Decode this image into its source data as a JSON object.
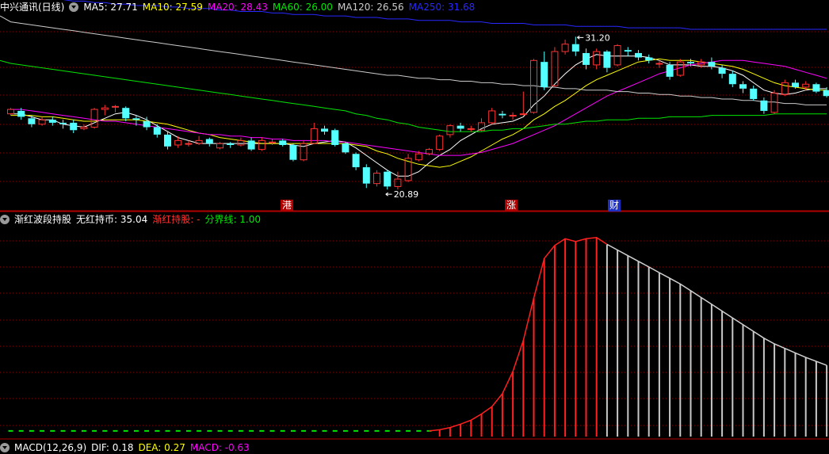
{
  "main_header": {
    "title": "中兴通讯(日线)",
    "ma5": "MA5: 27.71",
    "ma10": "MA10: 27.59",
    "ma20": "MA20: 28.43",
    "ma60": "MA60: 26.00",
    "ma120": "MA120: 26.56",
    "ma250": "MA250: 31.68"
  },
  "indicator_header": {
    "title": "渐红波段持股",
    "no_hold": "无红持币: 35.04",
    "hold": "渐红持股: -",
    "boundary": "分界线: 1.00"
  },
  "macd_header": {
    "title": "MACD(12,26,9)",
    "dif": "DIF: 0.18",
    "dea": "DEA: 0.27",
    "macd": "MACD: -0.63"
  },
  "annotations": {
    "high_label": "31.20",
    "low_label": "20.89",
    "tags": [
      "港",
      "涨",
      "财"
    ]
  },
  "colors": {
    "up": "#ff3232",
    "down": "#54ffff",
    "ma5": "#ffffff",
    "ma10": "#ffff00",
    "ma20": "#ff00ff",
    "ma60": "#00e600",
    "ma120": "#cccccc",
    "ma250": "#2828ff",
    "grid": "#8b0000"
  },
  "chart_data": [
    {
      "type": "candlestick",
      "ylim": [
        20,
        32.5
      ],
      "candles": [
        [
          26.0,
          26.3,
          26.4,
          25.9
        ],
        [
          26.2,
          25.8,
          26.4,
          25.6
        ],
        [
          25.7,
          25.3,
          25.9,
          25.1
        ],
        [
          25.3,
          25.6,
          25.8,
          25.2
        ],
        [
          25.6,
          25.4,
          25.8,
          25.2
        ],
        [
          25.4,
          25.3,
          25.6,
          25.0
        ],
        [
          25.4,
          24.9,
          25.6,
          24.7
        ],
        [
          25.0,
          25.1,
          25.3,
          24.9
        ],
        [
          25.1,
          26.3,
          26.4,
          25.0
        ],
        [
          26.3,
          26.4,
          26.6,
          25.9
        ],
        [
          26.5,
          26.5,
          26.6,
          26.1
        ],
        [
          26.4,
          25.7,
          26.5,
          25.5
        ],
        [
          25.7,
          25.6,
          25.9,
          25.2
        ],
        [
          25.5,
          25.1,
          25.8,
          24.9
        ],
        [
          25.1,
          24.6,
          25.3,
          24.4
        ],
        [
          24.6,
          23.8,
          24.8,
          23.6
        ],
        [
          23.9,
          24.2,
          24.5,
          23.7
        ],
        [
          24.0,
          24.0,
          24.2,
          23.8
        ],
        [
          24.0,
          24.2,
          24.5,
          23.9
        ],
        [
          24.3,
          24.0,
          24.4,
          23.8
        ],
        [
          23.7,
          24.0,
          24.1,
          23.6
        ],
        [
          24.0,
          23.9,
          24.1,
          23.7
        ],
        [
          23.9,
          24.2,
          24.4,
          23.8
        ],
        [
          24.2,
          23.6,
          24.4,
          23.5
        ],
        [
          23.6,
          24.2,
          24.4,
          23.5
        ],
        [
          24.1,
          24.1,
          24.3,
          23.9
        ],
        [
          24.2,
          23.9,
          24.3,
          23.8
        ],
        [
          23.9,
          22.9,
          24.0,
          22.8
        ],
        [
          22.9,
          24.0,
          24.2,
          22.8
        ],
        [
          24.0,
          25.0,
          25.4,
          24.0
        ],
        [
          25.0,
          24.8,
          25.2,
          24.6
        ],
        [
          24.9,
          23.9,
          25.0,
          23.8
        ],
        [
          24.0,
          23.4,
          24.1,
          23.3
        ],
        [
          23.3,
          22.4,
          23.4,
          22.2
        ],
        [
          22.4,
          21.3,
          22.6,
          21.0
        ],
        [
          21.3,
          22.0,
          22.2,
          21.1
        ],
        [
          22.1,
          21.1,
          22.2,
          20.9
        ],
        [
          21.1,
          21.6,
          22.1,
          20.9
        ],
        [
          21.5,
          23.0,
          23.3,
          21.4
        ],
        [
          22.9,
          23.3,
          23.5,
          22.8
        ],
        [
          23.3,
          23.6,
          23.7,
          23.2
        ],
        [
          23.6,
          24.5,
          24.6,
          23.5
        ],
        [
          24.6,
          25.2,
          25.3,
          24.4
        ],
        [
          25.2,
          25.0,
          25.4,
          24.8
        ],
        [
          25.0,
          25.0,
          25.2,
          24.8
        ],
        [
          24.9,
          25.4,
          25.7,
          24.8
        ],
        [
          25.4,
          26.2,
          26.4,
          25.3
        ],
        [
          26.0,
          25.9,
          26.2,
          25.7
        ],
        [
          25.9,
          25.9,
          26.1,
          25.6
        ],
        [
          26.0,
          26.0,
          27.5,
          25.9
        ],
        [
          26.1,
          29.6,
          29.7,
          26.0
        ],
        [
          29.5,
          27.8,
          30.2,
          27.6
        ],
        [
          27.9,
          30.2,
          30.5,
          27.8
        ],
        [
          30.2,
          30.7,
          31.0,
          30.0
        ],
        [
          30.7,
          30.2,
          31.2,
          29.9
        ],
        [
          30.1,
          29.3,
          30.4,
          29.0
        ],
        [
          29.3,
          30.2,
          30.4,
          29.0
        ],
        [
          30.2,
          29.1,
          30.3,
          28.8
        ],
        [
          29.3,
          30.6,
          30.7,
          29.2
        ],
        [
          30.3,
          30.2,
          30.5,
          29.9
        ],
        [
          30.1,
          29.8,
          30.3,
          29.6
        ],
        [
          29.8,
          29.6,
          30.0,
          29.4
        ],
        [
          29.4,
          29.4,
          29.6,
          29.1
        ],
        [
          29.3,
          28.5,
          29.5,
          28.3
        ],
        [
          28.6,
          29.5,
          29.7,
          28.5
        ],
        [
          29.5,
          29.4,
          29.7,
          29.2
        ],
        [
          29.3,
          29.5,
          29.7,
          29.1
        ],
        [
          29.5,
          29.2,
          29.8,
          29.0
        ],
        [
          29.1,
          28.7,
          29.3,
          28.4
        ],
        [
          28.7,
          28.0,
          28.9,
          27.8
        ],
        [
          28.0,
          27.7,
          28.2,
          27.4
        ],
        [
          27.7,
          27.0,
          27.9,
          26.9
        ],
        [
          26.9,
          26.2,
          27.1,
          26.0
        ],
        [
          26.1,
          27.4,
          27.6,
          26.0
        ],
        [
          27.3,
          28.1,
          28.3,
          27.2
        ],
        [
          28.1,
          27.8,
          28.3,
          27.7
        ],
        [
          27.8,
          28.0,
          28.2,
          27.6
        ],
        [
          28.0,
          27.5,
          28.1,
          27.4
        ],
        [
          27.6,
          27.2,
          27.8,
          27.1
        ]
      ],
      "ma_lines": {
        "ma5": [
          26.0,
          26.0,
          25.8,
          25.6,
          25.6,
          25.3,
          25.2,
          25.1,
          25.4,
          25.7,
          26.0,
          26.1,
          25.9,
          25.6,
          25.2,
          24.8,
          24.4,
          24.2,
          24.0,
          24.0,
          24.0,
          24.0,
          24.0,
          24.0,
          24.0,
          24.0,
          24.0,
          23.9,
          23.8,
          24.0,
          24.1,
          24.2,
          24.1,
          23.7,
          23.2,
          22.7,
          22.2,
          21.8,
          21.8,
          22.1,
          22.7,
          23.2,
          23.6,
          24.2,
          24.6,
          25.0,
          25.3,
          25.4,
          25.5,
          25.8,
          26.6,
          27.2,
          28.0,
          28.7,
          29.3,
          29.7,
          30.0,
          29.9,
          29.9,
          29.9,
          29.9,
          29.8,
          29.6,
          29.3,
          29.3,
          29.3,
          29.2,
          29.2,
          29.1,
          28.9,
          28.6,
          28.1,
          27.6,
          27.4,
          27.3,
          27.4,
          27.6,
          27.7,
          27.7
        ],
        "ma10": [
          25.9,
          25.9,
          25.9,
          25.8,
          25.8,
          25.7,
          25.6,
          25.5,
          25.5,
          25.6,
          25.6,
          25.6,
          25.6,
          25.5,
          25.4,
          25.3,
          25.1,
          24.9,
          24.7,
          24.6,
          24.4,
          24.3,
          24.2,
          24.1,
          24.0,
          24.0,
          24.0,
          24.0,
          24.0,
          24.0,
          24.0,
          24.0,
          24.0,
          23.9,
          23.8,
          23.5,
          23.3,
          23.0,
          22.8,
          22.6,
          22.5,
          22.4,
          22.5,
          22.8,
          23.1,
          23.5,
          23.9,
          24.3,
          24.6,
          25.0,
          25.6,
          26.0,
          26.5,
          26.9,
          27.4,
          27.9,
          28.3,
          28.6,
          28.9,
          29.2,
          29.5,
          29.6,
          29.7,
          29.6,
          29.6,
          29.6,
          29.5,
          29.4,
          29.3,
          29.2,
          29.0,
          28.7,
          28.4,
          28.1,
          27.9,
          27.8,
          27.7,
          27.6,
          27.6
        ],
        "ma20": [
          26.3,
          26.3,
          26.2,
          26.1,
          26.0,
          25.9,
          25.8,
          25.7,
          25.6,
          25.5,
          25.5,
          25.4,
          25.3,
          25.2,
          25.1,
          25.0,
          24.9,
          24.8,
          24.7,
          24.6,
          24.6,
          24.5,
          24.5,
          24.4,
          24.4,
          24.3,
          24.3,
          24.2,
          24.2,
          24.2,
          24.2,
          24.1,
          24.1,
          24.0,
          23.9,
          23.8,
          23.7,
          23.6,
          23.5,
          23.4,
          23.3,
          23.2,
          23.2,
          23.2,
          23.3,
          23.4,
          23.6,
          23.8,
          24.0,
          24.3,
          24.6,
          24.9,
          25.2,
          25.6,
          26.0,
          26.4,
          26.8,
          27.2,
          27.5,
          27.8,
          28.1,
          28.4,
          28.7,
          28.9,
          29.1,
          29.3,
          29.4,
          29.5,
          29.6,
          29.6,
          29.6,
          29.5,
          29.4,
          29.3,
          29.2,
          29.0,
          28.8,
          28.6,
          28.4
        ],
        "ma60": [
          29.4,
          29.3,
          29.2,
          29.1,
          29.0,
          28.9,
          28.8,
          28.7,
          28.6,
          28.5,
          28.4,
          28.3,
          28.2,
          28.1,
          28.0,
          27.9,
          27.8,
          27.7,
          27.6,
          27.5,
          27.4,
          27.3,
          27.2,
          27.1,
          27.0,
          26.9,
          26.8,
          26.7,
          26.6,
          26.5,
          26.4,
          26.3,
          26.2,
          26.0,
          25.9,
          25.7,
          25.6,
          25.4,
          25.3,
          25.1,
          25.0,
          24.9,
          24.8,
          24.8,
          24.8,
          24.8,
          24.9,
          24.9,
          25.0,
          25.0,
          25.1,
          25.2,
          25.3,
          25.3,
          25.4,
          25.5,
          25.5,
          25.6,
          25.6,
          25.6,
          25.7,
          25.7,
          25.7,
          25.8,
          25.8,
          25.8,
          25.8,
          25.9,
          25.9,
          25.9,
          25.9,
          25.9,
          25.9,
          26.0,
          26.0,
          26.0,
          26.0,
          26.0,
          26.0
        ],
        "ma120": [
          32.2,
          32.1,
          32.0,
          31.9,
          31.8,
          31.7,
          31.6,
          31.5,
          31.4,
          31.3,
          31.2,
          31.1,
          31.0,
          30.9,
          30.8,
          30.7,
          30.6,
          30.5,
          30.4,
          30.3,
          30.2,
          30.1,
          30.0,
          29.9,
          29.8,
          29.7,
          29.6,
          29.5,
          29.4,
          29.3,
          29.2,
          29.1,
          29.0,
          28.9,
          28.8,
          28.7,
          28.6,
          28.6,
          28.5,
          28.4,
          28.4,
          28.3,
          28.3,
          28.2,
          28.2,
          28.1,
          28.1,
          28.0,
          28.0,
          27.9,
          27.9,
          27.8,
          27.8,
          27.7,
          27.7,
          27.6,
          27.6,
          27.6,
          27.5,
          27.5,
          27.4,
          27.4,
          27.3,
          27.3,
          27.2,
          27.2,
          27.1,
          27.1,
          27.0,
          27.0,
          26.9,
          26.9,
          26.8,
          26.8,
          26.7,
          26.7,
          26.6,
          26.6,
          26.6
        ],
        "ma250": [
          33.9,
          33.9,
          33.8,
          33.8,
          33.7,
          33.7,
          33.6,
          33.6,
          33.5,
          33.5,
          33.4,
          33.4,
          33.3,
          33.3,
          33.3,
          33.2,
          33.2,
          33.1,
          33.1,
          33.1,
          33.0,
          33.0,
          32.9,
          32.9,
          32.9,
          32.8,
          32.8,
          32.7,
          32.7,
          32.7,
          32.6,
          32.6,
          32.6,
          32.5,
          32.5,
          32.5,
          32.4,
          32.4,
          32.4,
          32.3,
          32.3,
          32.3,
          32.3,
          32.2,
          32.2,
          32.2,
          32.1,
          32.1,
          32.1,
          32.1,
          32.0,
          32.0,
          32.0,
          32.0,
          31.9,
          31.9,
          31.9,
          31.9,
          31.9,
          31.8,
          31.8,
          31.8,
          31.8,
          31.8,
          31.8,
          31.7,
          31.7,
          31.7,
          31.7,
          31.7,
          31.7,
          31.7,
          31.7,
          31.7,
          31.7,
          31.7,
          31.7,
          31.7,
          31.7
        ]
      }
    },
    {
      "type": "bar",
      "title": "渐红波段持股",
      "ylim": [
        0,
        37
      ],
      "values": [
        1,
        1,
        1,
        1,
        1,
        1,
        1,
        1,
        1,
        1,
        1,
        1,
        1,
        1,
        1,
        1,
        1,
        1,
        1,
        1,
        1,
        1,
        1,
        1,
        1,
        1,
        1,
        1,
        1,
        1,
        1,
        1,
        1,
        1,
        1,
        1,
        1,
        1,
        1,
        1,
        1,
        1.2,
        1.6,
        2.2,
        2.9,
        4.0,
        5.3,
        7.6,
        11.5,
        17.0,
        24.5,
        31.5,
        33.8,
        35.0,
        34.5,
        35.0,
        35.2,
        34.0,
        33.0,
        32.0,
        31.0,
        30.0,
        29.0,
        28.0,
        27.0,
        25.8,
        24.6,
        23.4,
        22.2,
        21.0,
        19.8,
        18.6,
        17.4,
        16.4,
        15.6,
        14.8,
        14.0,
        13.3,
        12.6
      ],
      "state": [
        "g",
        "g",
        "g",
        "g",
        "g",
        "g",
        "g",
        "g",
        "g",
        "g",
        "g",
        "g",
        "g",
        "g",
        "g",
        "g",
        "g",
        "g",
        "g",
        "g",
        "g",
        "g",
        "g",
        "g",
        "g",
        "g",
        "g",
        "g",
        "g",
        "g",
        "g",
        "g",
        "g",
        "g",
        "g",
        "g",
        "g",
        "g",
        "g",
        "g",
        "g",
        "r",
        "r",
        "r",
        "r",
        "r",
        "r",
        "r",
        "r",
        "r",
        "r",
        "r",
        "r",
        "r",
        "r",
        "r",
        "r",
        "w",
        "w",
        "w",
        "w",
        "w",
        "w",
        "w",
        "w",
        "w",
        "w",
        "w",
        "w",
        "w",
        "w",
        "w",
        "w",
        "w",
        "w",
        "w",
        "w",
        "w",
        "w"
      ]
    }
  ]
}
